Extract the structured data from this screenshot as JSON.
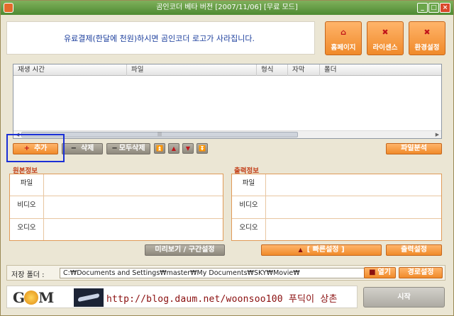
{
  "window": {
    "title": "곰인코더 베타 버전 [2007/11/06] [무료 모드]"
  },
  "notice": {
    "text": "유료결제(한달에 천원)하시면 곰인코더 로고가 사라집니다."
  },
  "top_buttons": [
    {
      "label": "홈페이지",
      "icon": "home-icon"
    },
    {
      "label": "라이센스",
      "icon": "license-icon"
    },
    {
      "label": "환경설정",
      "icon": "settings-icon"
    }
  ],
  "file_list": {
    "columns": [
      "재생 시간",
      "파일",
      "형식",
      "자막",
      "폴더"
    ],
    "rows": []
  },
  "list_buttons": {
    "add": "추가",
    "delete": "삭제",
    "delete_all": "모두삭제",
    "analyze": "파일분석"
  },
  "source_info": {
    "title": "원본정보",
    "rows": [
      "파일",
      "비디오",
      "오디오"
    ]
  },
  "output_info": {
    "title": "출력정보",
    "rows": [
      "파일",
      "비디오",
      "오디오"
    ]
  },
  "action_buttons": {
    "preview": "미리보기 / 구간설정",
    "quick_settings": "[ 빠른설정 ]",
    "output_settings": "출력설정"
  },
  "save": {
    "label": "저장 폴더 :",
    "path": "C:₩Documents and Settings₩master₩My Documents₩SKY₩Movie₩",
    "open": "열기",
    "path_settings": "경로설정"
  },
  "footer": {
    "logo_left": "G",
    "logo_right": "M",
    "blog_text": "http://blog.daum.net/woonsoo100 푸딕이 상촌",
    "start": "시작"
  },
  "colors": {
    "accent": "#f08a2a",
    "title_bar": "#4e8a31",
    "section_title": "#c3401a",
    "selection": "#1b2fd6"
  }
}
